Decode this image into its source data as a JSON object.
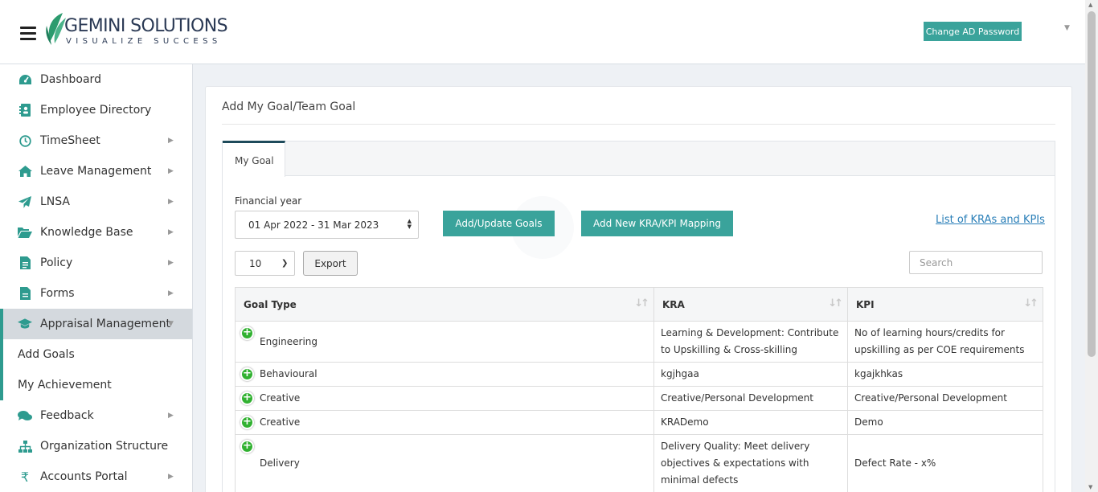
{
  "header": {
    "logo_main": "GEMINI SOLUTIONS",
    "logo_sub": "VISUALIZE SUCCESS",
    "change_password": "Change AD Password"
  },
  "sidebar": {
    "items": [
      {
        "label": "Dashboard",
        "icon": "dashboard-icon"
      },
      {
        "label": "Employee Directory",
        "icon": "address-book-icon"
      },
      {
        "label": "TimeSheet",
        "icon": "clock-icon"
      },
      {
        "label": "Leave Management",
        "icon": "home-icon"
      },
      {
        "label": "LNSA",
        "icon": "paper-plane-icon"
      },
      {
        "label": "Knowledge Base",
        "icon": "folder-open-icon"
      },
      {
        "label": "Policy",
        "icon": "document-icon"
      },
      {
        "label": "Forms",
        "icon": "file-icon"
      },
      {
        "label": "Appraisal Management",
        "icon": "graduation-cap-icon"
      },
      {
        "label": "Add Goals"
      },
      {
        "label": "My Achievement"
      },
      {
        "label": "Feedback",
        "icon": "comments-icon"
      },
      {
        "label": "Organization Structure",
        "icon": "sitemap-icon"
      },
      {
        "label": "Accounts Portal",
        "icon": "rupee-icon"
      }
    ]
  },
  "card": {
    "title": "Add My Goal/Team Goal",
    "tab": "My Goal"
  },
  "form": {
    "fy_label": "Financial year",
    "fy_value": "01 Apr 2022 - 31 Mar 2023",
    "add_update": "Add/Update Goals",
    "add_mapping": "Add New KRA/KPI Mapping",
    "kra_link": "List of KRAs and KPIs",
    "page_length": "10",
    "export": "Export",
    "search_placeholder": "Search"
  },
  "table": {
    "headers": [
      "Goal Type",
      "KRA",
      "KPI"
    ],
    "rows": [
      {
        "goal": "Engineering",
        "kra": "Learning & Development: Contribute to Upskilling & Cross-skilling",
        "kpi": "No of learning hours/credits for upskilling as per COE requirements"
      },
      {
        "goal": "Behavioural",
        "kra": "kgjhgaa",
        "kpi": "kgajkhkas"
      },
      {
        "goal": "Creative",
        "kra": "Creative/Personal Development",
        "kpi": "Creative/Personal Development"
      },
      {
        "goal": "Creative",
        "kra": "KRADemo",
        "kpi": "Demo"
      },
      {
        "goal": "Delivery",
        "kra": "Delivery Quality: Meet delivery objectives & expectations with minimal defects",
        "kpi": "Defect Rate - x%"
      }
    ]
  },
  "colors": {
    "accent": "#3aa39b",
    "sidebar_icon": "#2e9b8f",
    "tab_top": "#1e4b5b",
    "link": "#2a7fb8",
    "plus": "#31b131"
  }
}
